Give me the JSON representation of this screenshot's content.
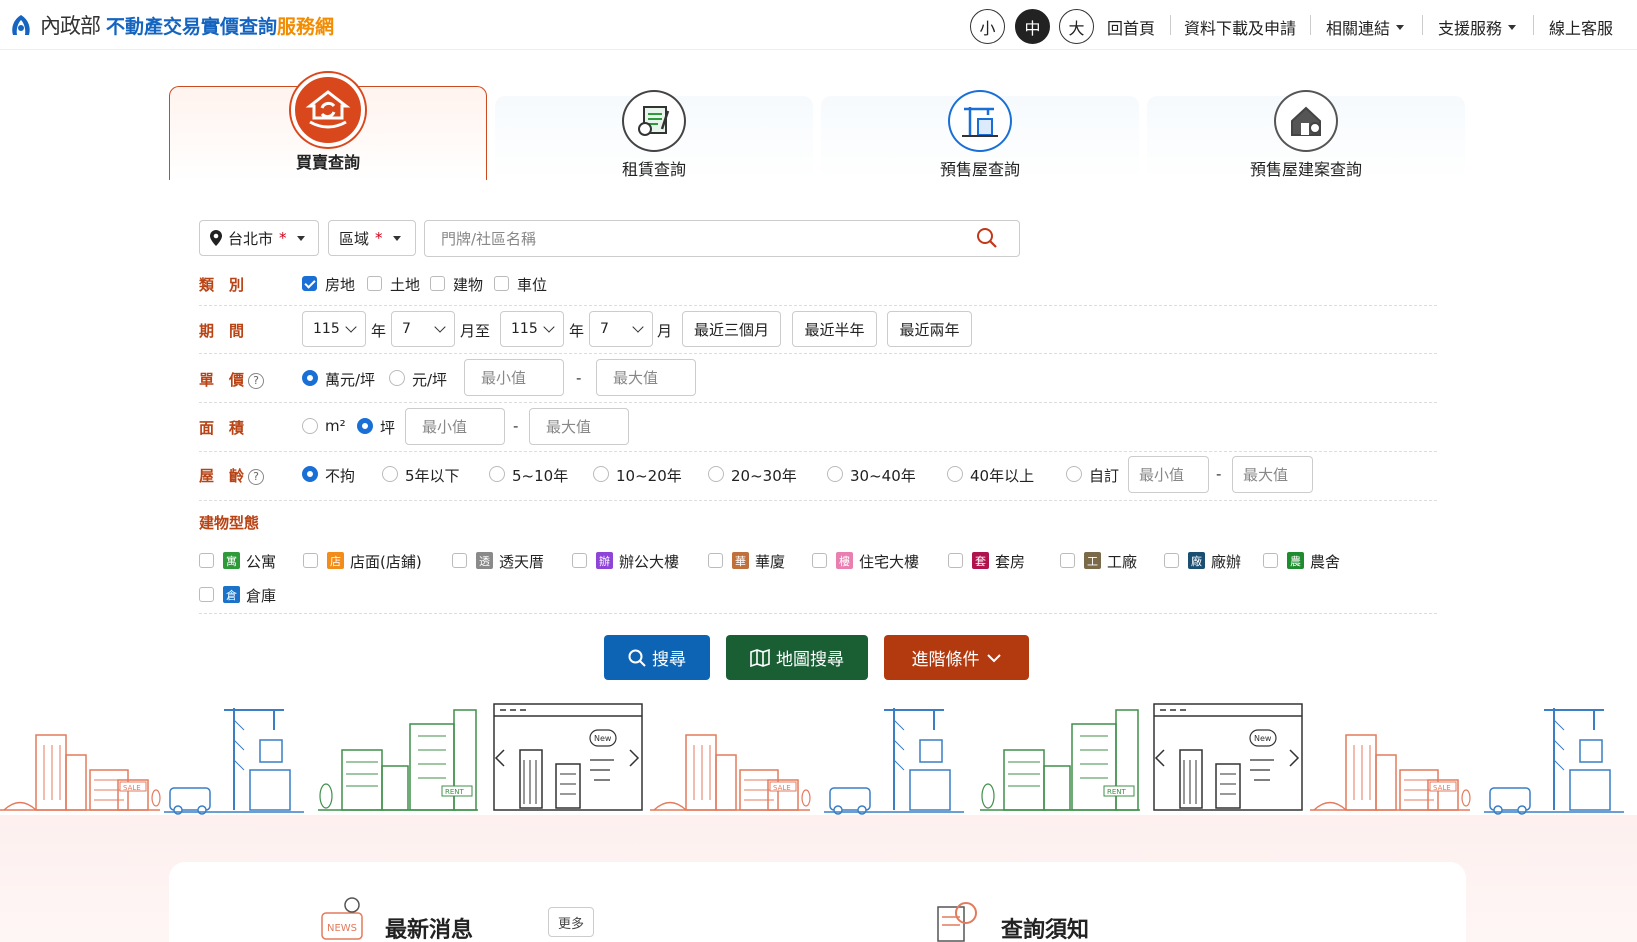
{
  "header": {
    "logo_ministry": "內政部",
    "logo_title": "不動產交易實價查詢",
    "logo_suffix": "服務網",
    "font_sizes": [
      "小",
      "中",
      "大"
    ],
    "font_size_selected": "中",
    "nav": [
      {
        "label": "回首頁",
        "dropdown": false
      },
      {
        "label": "資料下載及申請",
        "dropdown": false
      },
      {
        "label": "相關連結",
        "dropdown": true
      },
      {
        "label": "支援服務",
        "dropdown": true
      },
      {
        "label": "線上客服",
        "dropdown": false
      }
    ]
  },
  "tabs": [
    {
      "label": "買賣查詢",
      "icon": "house-exchange-icon",
      "active": true
    },
    {
      "label": "租賃查詢",
      "icon": "rent-document-icon",
      "active": false
    },
    {
      "label": "預售屋查詢",
      "icon": "crane-building-icon",
      "active": false
    },
    {
      "label": "預售屋建案查詢",
      "icon": "house-search-icon",
      "active": false
    }
  ],
  "search": {
    "city": "台北市",
    "district": "區域",
    "required_mark": "*",
    "keyword_placeholder": "門牌/社區名稱"
  },
  "filters": {
    "category": {
      "label": "類　別",
      "options": [
        {
          "label": "房地",
          "checked": true
        },
        {
          "label": "土地",
          "checked": false
        },
        {
          "label": "建物",
          "checked": false
        },
        {
          "label": "車位",
          "checked": false
        }
      ]
    },
    "period": {
      "label": "期　間",
      "start_year": "115",
      "start_month": "7",
      "end_year": "115",
      "end_month": "7",
      "year_unit": "年",
      "month_to": "月至",
      "month_unit": "月",
      "presets": [
        "最近三個月",
        "最近半年",
        "最近兩年"
      ]
    },
    "unit_price": {
      "label": "單　價",
      "units": [
        {
          "label": "萬元/坪",
          "selected": true
        },
        {
          "label": "元/坪",
          "selected": false
        }
      ],
      "min_placeholder": "最小值",
      "max_placeholder": "最大值",
      "separator": "-"
    },
    "area": {
      "label": "面　積",
      "units": [
        {
          "label": "m²",
          "selected": false
        },
        {
          "label": "坪",
          "selected": true
        }
      ],
      "min_placeholder": "最小值",
      "max_placeholder": "最大值"
    },
    "age": {
      "label": "屋　齡",
      "options": [
        {
          "label": "不拘",
          "selected": true
        },
        {
          "label": "5年以下",
          "selected": false
        },
        {
          "label": "5~10年",
          "selected": false
        },
        {
          "label": "10~20年",
          "selected": false
        },
        {
          "label": "20~30年",
          "selected": false
        },
        {
          "label": "30~40年",
          "selected": false
        },
        {
          "label": "40年以上",
          "selected": false
        },
        {
          "label": "自訂",
          "selected": false
        }
      ],
      "min_placeholder": "最小值",
      "max_placeholder": "最大值"
    },
    "building_type": {
      "label": "建物型態",
      "types": [
        {
          "badge": "寓",
          "label": "公寓",
          "color": "#2e9a3a"
        },
        {
          "badge": "店",
          "label": "店面(店鋪)",
          "color": "#f28c1a"
        },
        {
          "badge": "透",
          "label": "透天厝",
          "color": "#8a8a8a"
        },
        {
          "badge": "辦",
          "label": "辦公大樓",
          "color": "#8e44d6"
        },
        {
          "badge": "華",
          "label": "華廈",
          "color": "#c0703a"
        },
        {
          "badge": "樓",
          "label": "住宅大樓",
          "color": "#e87fb0"
        },
        {
          "badge": "套",
          "label": "套房",
          "color": "#b0124e"
        },
        {
          "badge": "工",
          "label": "工廠",
          "color": "#7a6a4a"
        },
        {
          "badge": "廠",
          "label": "廠辦",
          "color": "#1b4f72"
        },
        {
          "badge": "農",
          "label": "農舍",
          "color": "#1f8c2f"
        },
        {
          "badge": "倉",
          "label": "倉庫",
          "color": "#1a73c9"
        }
      ]
    }
  },
  "actions": {
    "search": "搜尋",
    "map_search": "地圖搜尋",
    "advanced": "進階條件"
  },
  "bottom": {
    "news_title": "最新消息",
    "news_more": "更多",
    "notice_title": "查詢須知"
  },
  "colors": {
    "accent": "#b84315",
    "primary": "#1565c0",
    "search_btn": "#0d64b4",
    "map_btn": "#1a5e34",
    "advanced_btn": "#b33a0f"
  }
}
